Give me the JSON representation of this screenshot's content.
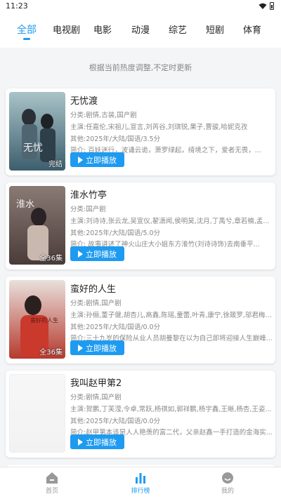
{
  "status_bar": {
    "time": "11:23"
  },
  "tabs": [
    {
      "label": "全部"
    },
    {
      "label": "电视剧"
    },
    {
      "label": "电影"
    },
    {
      "label": "动漫"
    },
    {
      "label": "综艺"
    },
    {
      "label": "短剧"
    },
    {
      "label": "体育"
    }
  ],
  "notice": "根据当前热度调整,不定时更新",
  "play_label": "立即播放",
  "cards": [
    {
      "title": "无忧渡",
      "category": "分类:剧情,古装,国产剧",
      "cast": "主演:任嘉伦,宋祖儿,宣言,刘芮谷,刘琪锐,果子,曹骏,哈妮克孜",
      "other": "其他:2025年/大陆/国语/3.5分",
      "intro": "简介:    百妖迷行，波诵云诡，萧罗绿起，绮境之下，爱者无畏，...",
      "badge": "完结",
      "poster_color_top": "#a9c3c8",
      "poster_color_bottom": "#3d5e6e"
    },
    {
      "title": "淮水竹亭",
      "category": "分类:国产剧",
      "cast": "主演:刘诗诗,张云龙,吴宣仪,翟潇闻,侯明昊,沈月,丁禹兮,章若楠,孟...",
      "other": "其他:2025年/大陆/国语/5.0分",
      "intro": "简介:    故事讲述了神火山庄大小姐东方淮竹(刘诗诗饰)去南垂平...",
      "badge": "全36集",
      "poster_color_top": "#8a7a74",
      "poster_color_bottom": "#4a3c3a"
    },
    {
      "title": "蛮好的人生",
      "category": "分类:剧情,国产剧",
      "cast": "主演:孙俪,董子健,胡杏儿,高鑫,陈瑶,童蕾,叶青,康宁,徐箴罗,邬君梅,...",
      "other": "其他:2025年/大陆/国语/0.0分",
      "intro": "简介:三十九岁的保险从业人员胡曼黎在以为自己即将迎接人生巅峰...",
      "badge": "全36集",
      "poster_color_top": "#e9e0dc",
      "poster_color_bottom": "#b53a2e"
    },
    {
      "title": "我叫赵甲第2",
      "category": "分类:剧情,国产剧",
      "cast": "主演:贺鹏,丁芙滢,令卓,常跃,杨祺如,郭祥鹏,杨宇鑫,王晰,杨杏,王姿...",
      "other": "其他:2025年/大陆/国语/0.0分",
      "intro": "简介:赵甲第本该是人人艳羡的富二代，父亲赵鑫一手打造的金海实...",
      "badge": "",
      "poster_color_top": "#f7f7f7",
      "poster_color_bottom": "#f2f2f2"
    }
  ],
  "bottom_nav": [
    {
      "label": "首页",
      "icon": "home-icon"
    },
    {
      "label": "排行榜",
      "icon": "chart-icon"
    },
    {
      "label": "我的",
      "icon": "profile-icon"
    }
  ],
  "colors": {
    "accent": "#1e9bf0",
    "background": "#f4f5f7"
  }
}
